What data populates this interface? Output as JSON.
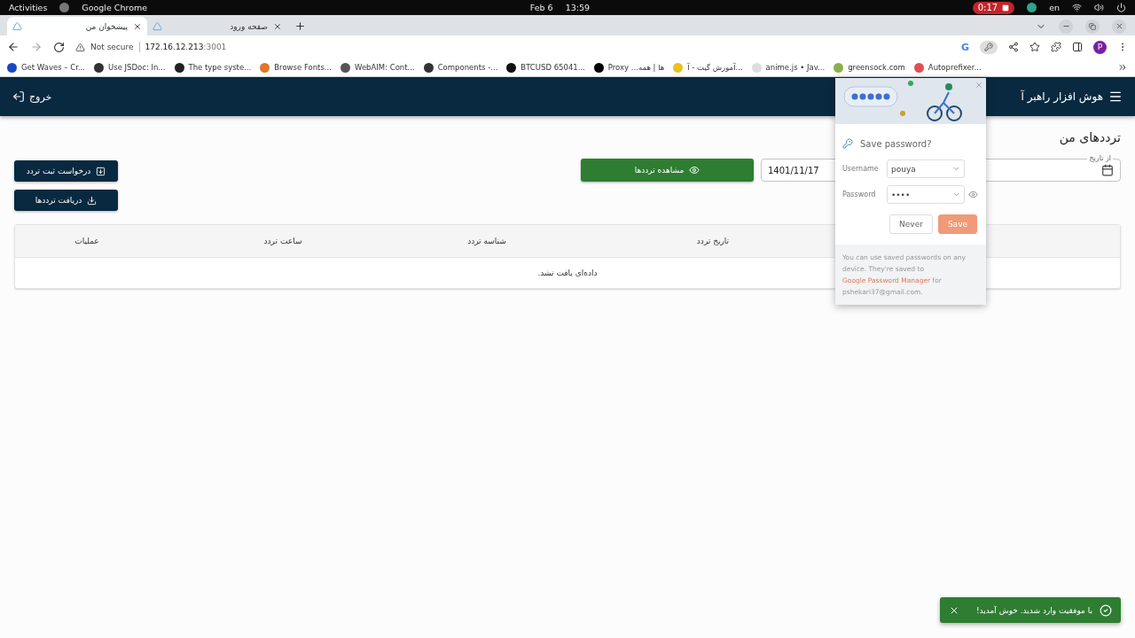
{
  "system_bar": {
    "activities": "Activities",
    "app": "Google Chrome",
    "date": "Feb 6",
    "time": "13:59",
    "recording": "0:17",
    "language": "en"
  },
  "tabs": [
    {
      "title": "صفحه ورود",
      "selected": false
    },
    {
      "title": "پیشخوان من",
      "selected": true
    }
  ],
  "address_bar": {
    "security": "Not secure",
    "host": "172.16.12.213",
    "port": ":3001",
    "lens_badge": "G",
    "profile": "P"
  },
  "bookmarks": [
    {
      "title": "Autoprefixer...",
      "color": "#e05050"
    },
    {
      "title": "greensock.com",
      "color": "#88b04b"
    },
    {
      "title": "anime.js • Jav...",
      "color": "#dddddd"
    },
    {
      "title": "آموزش گیت - آ...",
      "color": "#e8c020"
    },
    {
      "title": "Proxy ...ها | همه",
      "color": "#000000"
    },
    {
      "title": "BTCUSD 65041...",
      "color": "#111111"
    },
    {
      "title": "Components -...",
      "color": "#333333"
    },
    {
      "title": "WebAIM: Cont...",
      "color": "#555555"
    },
    {
      "title": "Browse Fonts...",
      "color": "#e0762a"
    },
    {
      "title": "The type syste...",
      "color": "#222222"
    },
    {
      "title": "Use JSDoc: In...",
      "color": "#333333"
    },
    {
      "title": "Get Waves – Cr...",
      "color": "#1a47c8"
    }
  ],
  "app_header": {
    "title": "هوش افزار راهبر آ",
    "logout": "خروج"
  },
  "page": {
    "title": "ترددهای من",
    "from_date": {
      "label": "از تاریخ"
    },
    "to_date": {
      "value": "1401/11/17"
    },
    "view_button": "مشاهده ترددها",
    "actions": [
      {
        "label": "درخواست ثبت تردد",
        "kind": "request"
      },
      {
        "label": "دریافت ترددها",
        "kind": "download"
      }
    ]
  },
  "table": {
    "columns": [
      "تاریخ تردد",
      "شناسه تردد",
      "ساعت تردد",
      "عملیات"
    ],
    "empty": "داده‌ای یافت نشد."
  },
  "password_popup": {
    "title": "Save password?",
    "username_label": "Username",
    "username": "pouya",
    "password_label": "Password",
    "password": "••••",
    "buttons": [
      "Save",
      "Never"
    ],
    "note": "You can use saved passwords on any device. They're saved to ",
    "link": "Google Password Manager",
    "note_end": " for pshekari37@gmail.com."
  },
  "toast": {
    "message": "با موفقیت وارد شدید. خوش آمدید!"
  }
}
